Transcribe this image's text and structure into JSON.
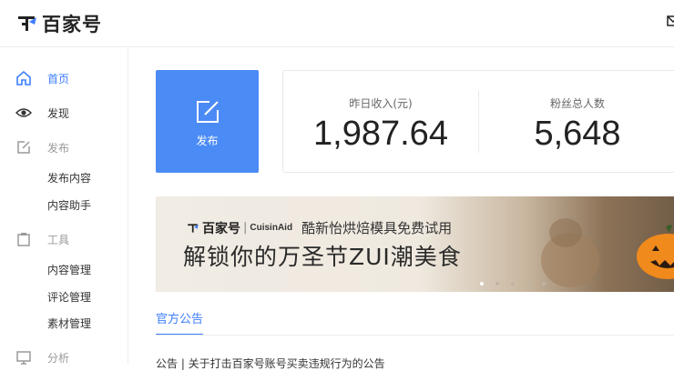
{
  "header": {
    "brand": "百家号"
  },
  "sidebar": {
    "items": [
      {
        "label": "首页",
        "icon": "home-icon",
        "kind": "active"
      },
      {
        "label": "发现",
        "icon": "eye-icon",
        "kind": "normal"
      },
      {
        "label": "发布",
        "icon": "edit-icon",
        "kind": "group"
      },
      {
        "label": "发布内容",
        "kind": "sub"
      },
      {
        "label": "内容助手",
        "kind": "sub"
      },
      {
        "label": "工具",
        "icon": "clipboard-icon",
        "kind": "group"
      },
      {
        "label": "内容管理",
        "kind": "sub"
      },
      {
        "label": "评论管理",
        "kind": "sub"
      },
      {
        "label": "素材管理",
        "kind": "sub"
      },
      {
        "label": "分析",
        "icon": "monitor-icon",
        "kind": "group"
      }
    ]
  },
  "publish_card": {
    "label": "发布",
    "icon": "edit-icon",
    "color": "#4b8bf5"
  },
  "stats": [
    {
      "label": "昨日收入(元)",
      "value": "1,987.64"
    },
    {
      "label": "粉丝总人数",
      "value": "5,648"
    }
  ],
  "banner": {
    "brand": "百家号",
    "partner": "CuisinAid",
    "tagline": "酷新怡烘焙模具免费试用",
    "title": "解锁你的万圣节ZUI潮美食",
    "slides": 5,
    "active_slide": 1
  },
  "tabs": {
    "active": "官方公告"
  },
  "notice": {
    "text": "公告 | 关于打击百家号账号买卖违规行为的公告"
  },
  "colors": {
    "accent": "#3d7eff",
    "publish": "#4b8bf5"
  }
}
